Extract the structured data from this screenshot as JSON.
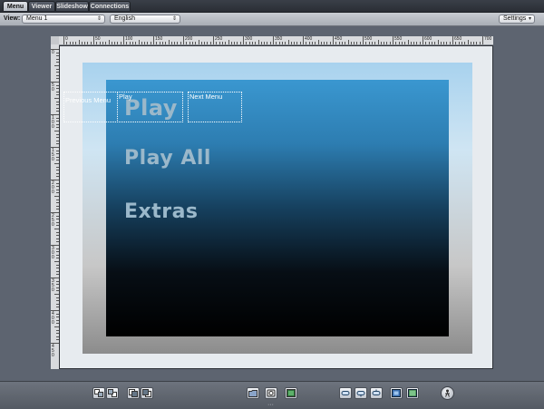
{
  "tabs": [
    "Menu",
    "Viewer",
    "Slideshow",
    "Connections"
  ],
  "toolbar": {
    "view_label": "View:",
    "view_value": "Menu 1",
    "language_value": "English",
    "settings_label": "Settings"
  },
  "ruler": {
    "top_labels": [
      "0",
      "50",
      "100",
      "150",
      "200",
      "250",
      "300",
      "350",
      "400",
      "450",
      "500",
      "550",
      "600",
      "650",
      "700"
    ],
    "left_labels": [
      "0",
      "50",
      "100",
      "150",
      "200",
      "250",
      "300",
      "350",
      "400",
      "450"
    ]
  },
  "menu": {
    "buttons": [
      "Play",
      "Play All",
      "Extras"
    ],
    "selection_labels": {
      "previous": "Previous Menu",
      "play": "Play",
      "next": "Next Menu"
    }
  },
  "bottom_icons": [
    "bring-forward-icon",
    "send-backward-icon",
    "bring-to-front-icon",
    "send-to-back-icon",
    "folder-icon",
    "disc-icon",
    "monitor-icon",
    "align-left-icon",
    "align-center-icon",
    "align-right-icon",
    "fit-frame-icon",
    "fill-frame-icon",
    "simulator-icon"
  ]
}
